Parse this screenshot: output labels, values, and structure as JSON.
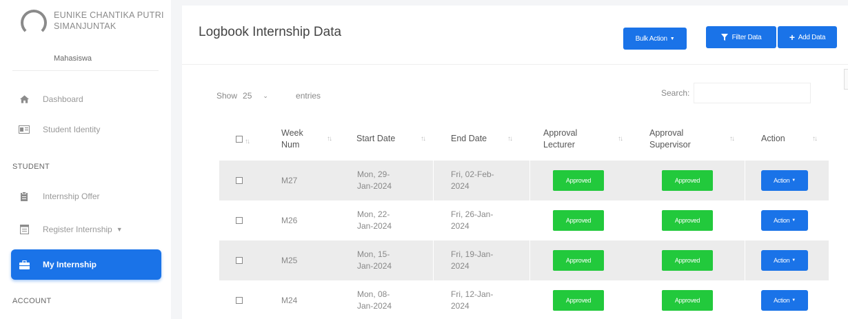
{
  "user": {
    "name": "EUNIKE CHANTIKA PUTRI SIMANJUNTAK",
    "role": "Mahasiswa"
  },
  "sidebar": {
    "items": [
      {
        "label": "Dashboard",
        "icon": "home-icon"
      },
      {
        "label": "Student Identity",
        "icon": "id-card-icon"
      }
    ],
    "section_student": "STUDENT",
    "student_items": [
      {
        "label": "Internship Offer",
        "icon": "clipboard-icon"
      },
      {
        "label": "Register Internship",
        "icon": "form-icon"
      },
      {
        "label": "My Internship",
        "icon": "briefcase-icon",
        "active": true
      }
    ],
    "section_account": "ACCOUNT"
  },
  "page": {
    "title": "Logbook Internship Data",
    "bulk_action": "Bulk Action",
    "filter_data": "Filter Data",
    "add_data": "Add Data"
  },
  "table_controls": {
    "show_label": "Show",
    "show_value": "25",
    "entries_label": "entries",
    "search_label": "Search:"
  },
  "table": {
    "headers": {
      "week_num": "Week Num",
      "start_date": "Start Date",
      "end_date": "End Date",
      "approval_lecturer": "Approval Lecturer",
      "approval_supervisor": "Approval Supervisor",
      "action": "Action"
    },
    "rows": [
      {
        "week": "M27",
        "start": "Mon, 29-Jan-2024",
        "end": "Fri, 02-Feb-2024",
        "lecturer": "Approved",
        "supervisor": "Approved",
        "action": "Action"
      },
      {
        "week": "M26",
        "start": "Mon, 22-Jan-2024",
        "end": "Fri, 26-Jan-2024",
        "lecturer": "Approved",
        "supervisor": "Approved",
        "action": "Action"
      },
      {
        "week": "M25",
        "start": "Mon, 15-Jan-2024",
        "end": "Fri, 19-Jan-2024",
        "lecturer": "Approved",
        "supervisor": "Approved",
        "action": "Action"
      },
      {
        "week": "M24",
        "start": "Mon, 08-Jan-2024",
        "end": "Fri, 12-Jan-2024",
        "lecturer": "Approved",
        "supervisor": "Approved",
        "action": "Action"
      }
    ]
  },
  "colors": {
    "primary": "#1a73e8",
    "approved": "#22c93c"
  }
}
